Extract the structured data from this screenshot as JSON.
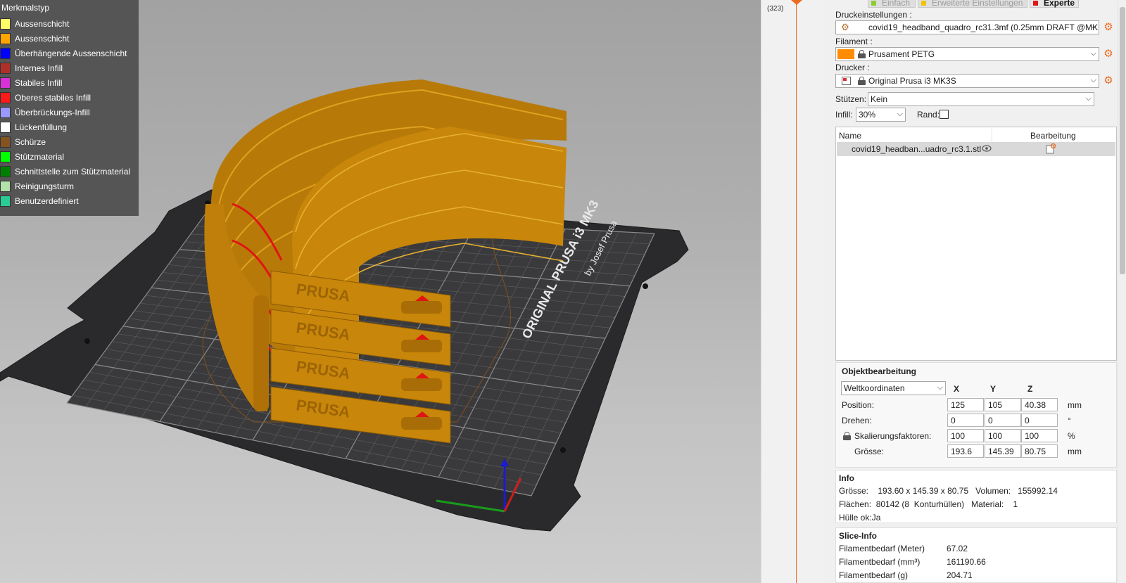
{
  "legend": {
    "title": "Merkmalstyp",
    "items": [
      {
        "label": "Aussenschicht",
        "color": "#FFFF68"
      },
      {
        "label": "Aussenschicht",
        "color": "#FFA500"
      },
      {
        "label": "Überhängende Aussenschicht",
        "color": "#0000FF"
      },
      {
        "label": "Internes Infill",
        "color": "#B03029"
      },
      {
        "label": "Stabiles Infill",
        "color": "#D732D7"
      },
      {
        "label": "Oberes stabiles Infill",
        "color": "#FF1A1A"
      },
      {
        "label": "Überbrückungs-Infill",
        "color": "#9999FF"
      },
      {
        "label": "Lückenfüllung",
        "color": "#FFFFFF"
      },
      {
        "label": "Schürze",
        "color": "#845321"
      },
      {
        "label": "Stützmaterial",
        "color": "#00FF00"
      },
      {
        "label": "Schnittstelle zum Stützmaterial",
        "color": "#008000"
      },
      {
        "label": "Reinigungsturm",
        "color": "#B3E3AB"
      },
      {
        "label": "Benutzerdefiniert",
        "color": "#28CC94"
      }
    ]
  },
  "layer_slider": {
    "count": "(323)"
  },
  "model_color": "#C8860A",
  "mode_tabs": [
    {
      "label": "Einfach",
      "color": "#8CCC33"
    },
    {
      "label": "Erweiterte Einstellungen",
      "color": "#F2C400"
    },
    {
      "label": "Experte",
      "color": "#E01414"
    }
  ],
  "sidebar": {
    "print_settings_label": "Druckeinstellungen :",
    "print_settings_value": "covid19_headband_quadro_rc31.3mf (0.25mm DRAFT @MK",
    "filament_label": "Filament :",
    "filament_value": "Prusament PETG",
    "filament_color": "#FF8C00",
    "printer_label": "Drucker :",
    "printer_value": "Original Prusa i3 MK3S",
    "supports_label": "Stützen:",
    "supports_value": "Kein",
    "infill_label": "Infill:",
    "infill_value": "30%",
    "brim_label": "Rand:"
  },
  "object_list": {
    "col_name": "Name",
    "col_edit": "Bearbeitung",
    "items": [
      {
        "name": "covid19_headban...uadro_rc3.1.stl"
      }
    ]
  },
  "object_edit": {
    "title": "Objektbearbeitung",
    "coord_system": "Weltkoordinaten",
    "axes": [
      "X",
      "Y",
      "Z"
    ],
    "position": {
      "label": "Position:",
      "x": "125",
      "y": "105",
      "z": "40.38",
      "unit": "mm"
    },
    "rotate": {
      "label": "Drehen:",
      "x": "0",
      "y": "0",
      "z": "0",
      "unit": "°"
    },
    "scale": {
      "label": "Skalierungsfaktoren:",
      "x": "100",
      "y": "100",
      "z": "100",
      "unit": "%"
    },
    "size": {
      "label": "Grösse:",
      "x": "193.6",
      "y": "145.39",
      "z": "80.75",
      "unit": "mm"
    }
  },
  "info": {
    "title": "Info",
    "size_line": "Grösse:    193.60 x 145.39 x 80.75   Volumen:   155992.14",
    "faces_line": "Flächen:  80142 (8  Konturhüllen)   Material:    1",
    "hull_line": "Hülle ok:Ja"
  },
  "slice_info": {
    "title": "Slice-Info",
    "rows": [
      {
        "label": "Filamentbedarf (Meter)",
        "value": "67.02"
      },
      {
        "label": "Filamentbedarf (mm³)",
        "value": "161190.66"
      },
      {
        "label": "Filamentbedarf (g)",
        "value": "204.71"
      }
    ]
  },
  "bed": {
    "brand_line1": "ORIGINAL PRUSA i3 MK3",
    "brand_line2": "by Josef Prusa",
    "part_text": "PRUSA"
  }
}
